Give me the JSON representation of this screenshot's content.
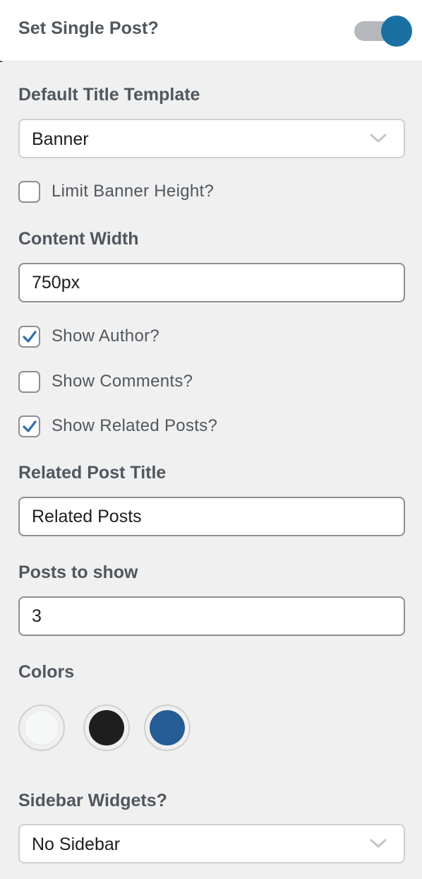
{
  "header": {
    "title": "Set Single Post?",
    "toggle_enabled": true,
    "toggle_color": "#1a6fa3"
  },
  "default_title_template": {
    "label": "Default Title Template",
    "selected": "Banner",
    "icon": "chevron-down-icon"
  },
  "limit_banner_height": {
    "label": "Limit Banner Height?",
    "checked": false
  },
  "content_width": {
    "label": "Content Width",
    "value": "750px"
  },
  "checkboxes": [
    {
      "label": "Show Author?",
      "checked": true
    },
    {
      "label": "Show Comments?",
      "checked": false
    },
    {
      "label": "Show Related Posts?",
      "checked": true
    }
  ],
  "related_post_title": {
    "label": "Related Post Title",
    "value": "Related Posts"
  },
  "posts_to_show": {
    "label": "Posts to show",
    "value": "3"
  },
  "colors": {
    "label": "Colors",
    "swatches": [
      {
        "name": "white",
        "hex": "#f6f7f7"
      },
      {
        "name": "black",
        "hex": "#1e1e1e"
      },
      {
        "name": "blue",
        "hex": "#265c93"
      }
    ]
  },
  "sidebar_widgets": {
    "label": "Sidebar Widgets?",
    "selected": "No Sidebar",
    "icon": "chevron-down-icon"
  },
  "accent_color": "#2d6fb0"
}
